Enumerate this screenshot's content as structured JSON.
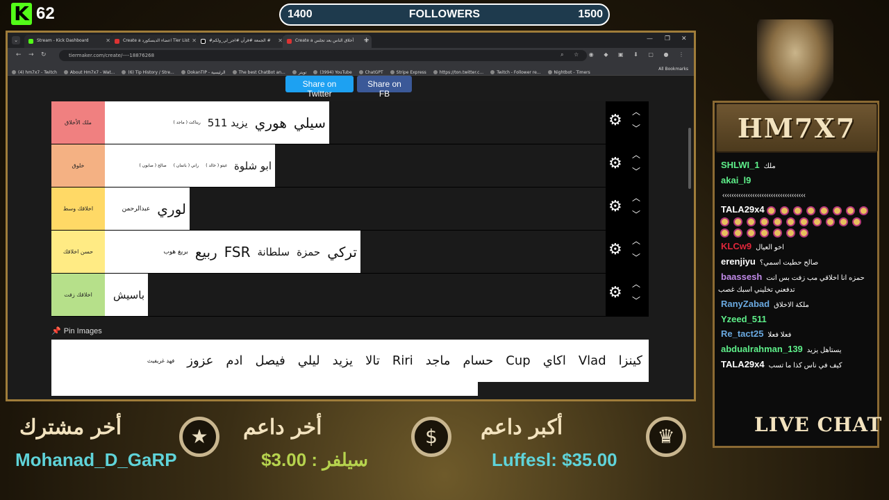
{
  "overlay": {
    "kick_logo": "K",
    "viewer_count": "62",
    "followers": {
      "title": "FOLLOWERS",
      "current": "1400",
      "goal": "1500",
      "progress_fraction": 0.0
    }
  },
  "browser": {
    "tabs": [
      {
        "label": "Stream - Kick Dashboard",
        "active": false
      },
      {
        "label": "Create a اعضاء الديسكورد Tier List",
        "active": false
      },
      {
        "label": "#الجمعة #قرآن #اجر_لي_ولكم #",
        "active": false
      },
      {
        "label": "Create a أخلاق الناس بعد تجلس",
        "active": true
      }
    ],
    "url": "tiermaker.com/create/----18876268",
    "bookmarks": [
      "(4) hm7x7 - Twitch",
      "About Hm7x7 - Wat...",
      "(6) Tip History / Stre...",
      "DokanTIP - الرئيسية",
      "The best ChatBot an...",
      "تويتر",
      "(3994) YouTube",
      "ChatGPT",
      "Stripe Express",
      "https://ton.twitter.c...",
      "Twitch - Follower re...",
      "Nightbot - Timers"
    ],
    "all_bookmarks": "All Bookmarks"
  },
  "page": {
    "share_twitter": "Share on Twitter",
    "share_fb": "Share on FB",
    "tiers": [
      {
        "label": "ملك الأخلاق",
        "color": "#f08080",
        "items": [
          {
            "text": "سيلي",
            "size": "big"
          },
          {
            "text": "هوري",
            "size": "big"
          },
          {
            "text": "يزيد 511",
            "size": "med"
          },
          {
            "text": "ريناكت ( ماجد )",
            "size": "xs"
          }
        ]
      },
      {
        "label": "خلوق",
        "color": "#f4b183",
        "items": [
          {
            "text": "ابو شلوة",
            "size": "med"
          },
          {
            "text": "غيتو ( خالد )",
            "size": "xs"
          },
          {
            "text": "راني ( باتمان )",
            "size": "xs"
          },
          {
            "text": "صالح ( صابون )",
            "size": "xs"
          }
        ]
      },
      {
        "label": "اخلاقك وسط",
        "color": "#ffd966",
        "items": [
          {
            "text": "لوري",
            "size": "big"
          },
          {
            "text": "عبدالرحمن",
            "size": "sm"
          }
        ]
      },
      {
        "label": "حسن اخلاقك",
        "color": "#ffeb84",
        "items": [
          {
            "text": "تركي",
            "size": "big"
          },
          {
            "text": "حمزة",
            "size": "med"
          },
          {
            "text": "سلطانة",
            "size": "med"
          },
          {
            "text": "FSR",
            "size": "big"
          },
          {
            "text": "ربيع",
            "size": "big"
          },
          {
            "text": "بريغ هوب",
            "size": "sm"
          }
        ]
      },
      {
        "label": "اخلاقك زفت",
        "color": "#b6e08a",
        "items": [
          {
            "text": "باسيش",
            "size": "med"
          }
        ]
      }
    ],
    "pin_images_label": "Pin Images",
    "pool": [
      {
        "text": "كينزا",
        "size": "big"
      },
      {
        "text": "Vlad",
        "size": "big"
      },
      {
        "text": "اكاي",
        "size": "big"
      },
      {
        "text": "Cup",
        "size": "big"
      },
      {
        "text": "حسام",
        "size": "big"
      },
      {
        "text": "ماجد",
        "size": "big"
      },
      {
        "text": "Riri",
        "size": "big"
      },
      {
        "text": "تالا",
        "size": "big"
      },
      {
        "text": "يزيد",
        "size": "big"
      },
      {
        "text": "ليلي",
        "size": "big"
      },
      {
        "text": "فيصل",
        "size": "big"
      },
      {
        "text": "ادم",
        "size": "big"
      },
      {
        "text": "عزوز",
        "size": "big"
      },
      {
        "text": "فهد غريفيث",
        "size": "sm"
      }
    ]
  },
  "chat": {
    "title": "HM7X7",
    "live_label": "LIVE CHAT",
    "messages": [
      {
        "user": "SHLWI_1",
        "color": "#5ef08a",
        "text": "ملك"
      },
      {
        "user": "akai_l9",
        "color": "#5ef08a",
        "text": ""
      },
      {
        "user": "",
        "color": "#ffffff",
        "text": "‹‹‹‹‹‹‹‹‹‹‹‹‹‹‹‹‹‹‹‹‹‹‹‹‹‹‹‹‹‹‹‹‹‹‹‹"
      },
      {
        "user": "TALA29x4",
        "color": "#ffffff",
        "text": "",
        "emotes": 26
      },
      {
        "user": "KLCw9",
        "color": "#e0263a",
        "text": "اخو العيال"
      },
      {
        "user": "erenjiyu",
        "color": "#ffffff",
        "text": "صالح حطيت اسمي؟"
      },
      {
        "user": "baassesh",
        "color": "#c08ae8",
        "text": "حمزه انا اخلاقي مب زفت بس انت تدفعني تخليني اسبك غصب"
      },
      {
        "user": "RanyZabad",
        "color": "#6aa9e0",
        "text": "ملكة الاخلاق"
      },
      {
        "user": "Yzeed_511",
        "color": "#5ef08a",
        "text": ""
      },
      {
        "user": "Re_tact25",
        "color": "#6aa9e0",
        "text": "فعلا فعلا"
      },
      {
        "user": "abdualrahman_139",
        "color": "#5ef08a",
        "text": "يستاهل يزيد"
      },
      {
        "user": "TALA29x4",
        "color": "#ffffff",
        "text": "كيف في ناس كذا ما تسب"
      }
    ]
  },
  "bottom": {
    "last_sub_label": "أخر مشترك",
    "last_sub_value": "Mohanad_D_GaRP",
    "last_donor_label": "أخر داعم",
    "last_donor_value": "سيلفر : 3.00$",
    "top_donor_label": "أكبر داعم",
    "top_donor_value": "Luffesl: $35.00",
    "icons": [
      "star-icon",
      "dollar-icon",
      "crown-icon"
    ]
  }
}
